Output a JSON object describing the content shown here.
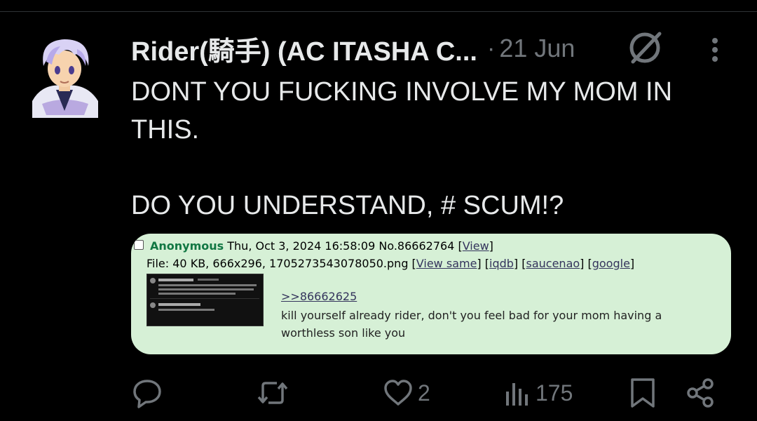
{
  "tweet": {
    "author": "Rider(騎手) (AC ITASHA C...",
    "separator": "·",
    "date": "21 Jun",
    "text": "DONT YOU FUCKING INVOLVE MY MOM IN THIS.\n\nDO YOU UNDERSTAND, # SCUM!?"
  },
  "embed": {
    "poster": "Anonymous",
    "datetime": "Thu, Oct 3, 2024 16:58:09",
    "post_number": "No.86662764",
    "view_link": "View",
    "file_info": "File: 40 KB, 666x296, 1705273543078050.png",
    "links": [
      "View same",
      "iqdb",
      "saucenao",
      "google"
    ],
    "quote_link": ">>86662625",
    "reply_text": "kill yourself already rider, don't you feel bad for your mom having a worthless son like you"
  },
  "actions": {
    "replies": "",
    "reposts": "",
    "likes": "2",
    "views": "175"
  },
  "colors": {
    "background": "#000000",
    "text": "#e7e9ea",
    "muted": "#71767b",
    "card_bg": "#d6f0d6",
    "poster_green": "#117743",
    "link": "#34345c"
  },
  "icons": [
    "avatar",
    "grok-icon",
    "more-icon",
    "reply-icon",
    "repost-icon",
    "like-icon",
    "views-icon",
    "bookmark-icon",
    "share-icon"
  ]
}
